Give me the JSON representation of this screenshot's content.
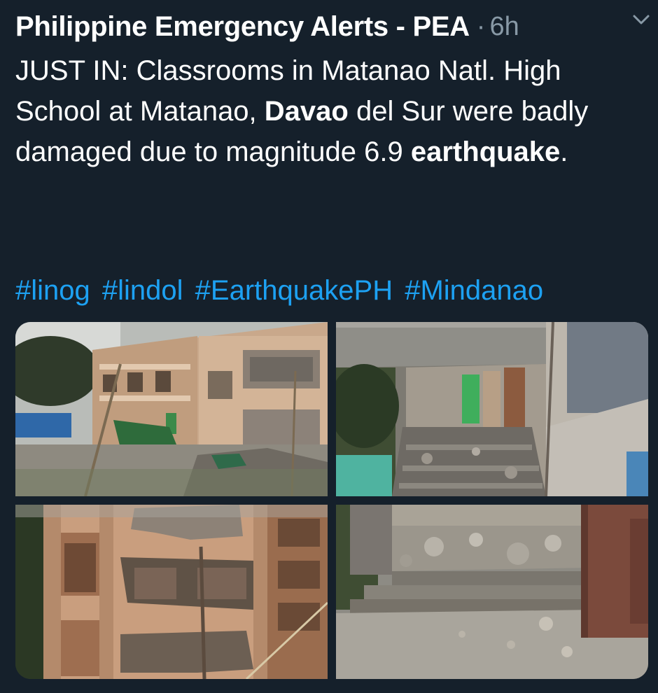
{
  "tweet": {
    "author_name": "Philippine Emergency Alerts - PEA",
    "separator": "·",
    "time": "6h",
    "text_part1": "JUST IN: Classrooms in Matanao Natl. High School at Matanao, ",
    "text_bold1": "Davao",
    "text_part2": " del Sur were badly damaged due to magnitude 6.9 ",
    "text_bold2": "earthquake",
    "text_part3": ".",
    "hashtags": [
      "#linog",
      "#lindol",
      "#EarthquakePH",
      "#Mindanao"
    ],
    "caret_icon": "chevron-down-icon"
  },
  "colors": {
    "background": "#15202b",
    "text": "#ffffff",
    "secondary": "#8899a6",
    "link": "#1da1f2"
  },
  "media": {
    "photo_count": 4
  }
}
